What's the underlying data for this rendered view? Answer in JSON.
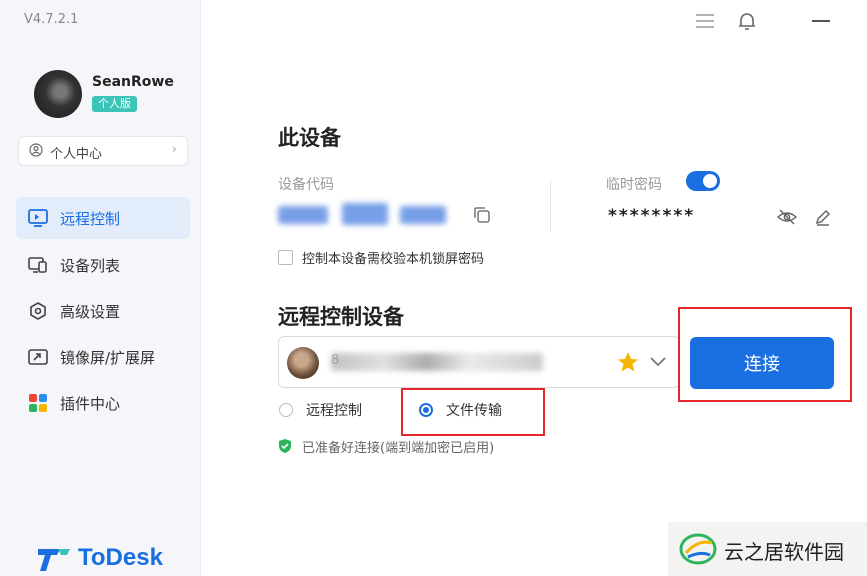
{
  "app": {
    "version": "V4.7.2.1"
  },
  "user": {
    "name": "SeanRowe",
    "badge": "个人版"
  },
  "personal_center": {
    "label": "个人中心"
  },
  "nav": [
    {
      "label": "远程控制",
      "icon": "monitor-icon",
      "active": true
    },
    {
      "label": "设备列表",
      "icon": "devices-icon",
      "active": false
    },
    {
      "label": "高级设置",
      "icon": "gear-icon",
      "active": false
    },
    {
      "label": "镜像屏/扩展屏",
      "icon": "mirror-screen-icon",
      "active": false
    },
    {
      "label": "插件中心",
      "icon": "plugin-icon",
      "active": false
    }
  ],
  "brand": {
    "name": "ToDesk"
  },
  "this_device": {
    "title": "此设备",
    "code_label": "设备代码",
    "temp_password_label": "临时密码",
    "temp_password_enabled": true,
    "temp_password_masked": "********",
    "lock_check_label": "控制本设备需校验本机锁屏密码"
  },
  "remote": {
    "title": "远程控制设备",
    "device_display": "8",
    "connect_label": "连接",
    "mode_options": [
      {
        "label": "远程控制",
        "selected": false
      },
      {
        "label": "文件传输",
        "selected": true
      }
    ],
    "status": "已准备好连接(端到端加密已启用)"
  },
  "watermark": {
    "text": "云之居软件园"
  },
  "colors": {
    "accent": "#1a6fe0",
    "highlight": "#e5262b",
    "success": "#2db55d"
  }
}
